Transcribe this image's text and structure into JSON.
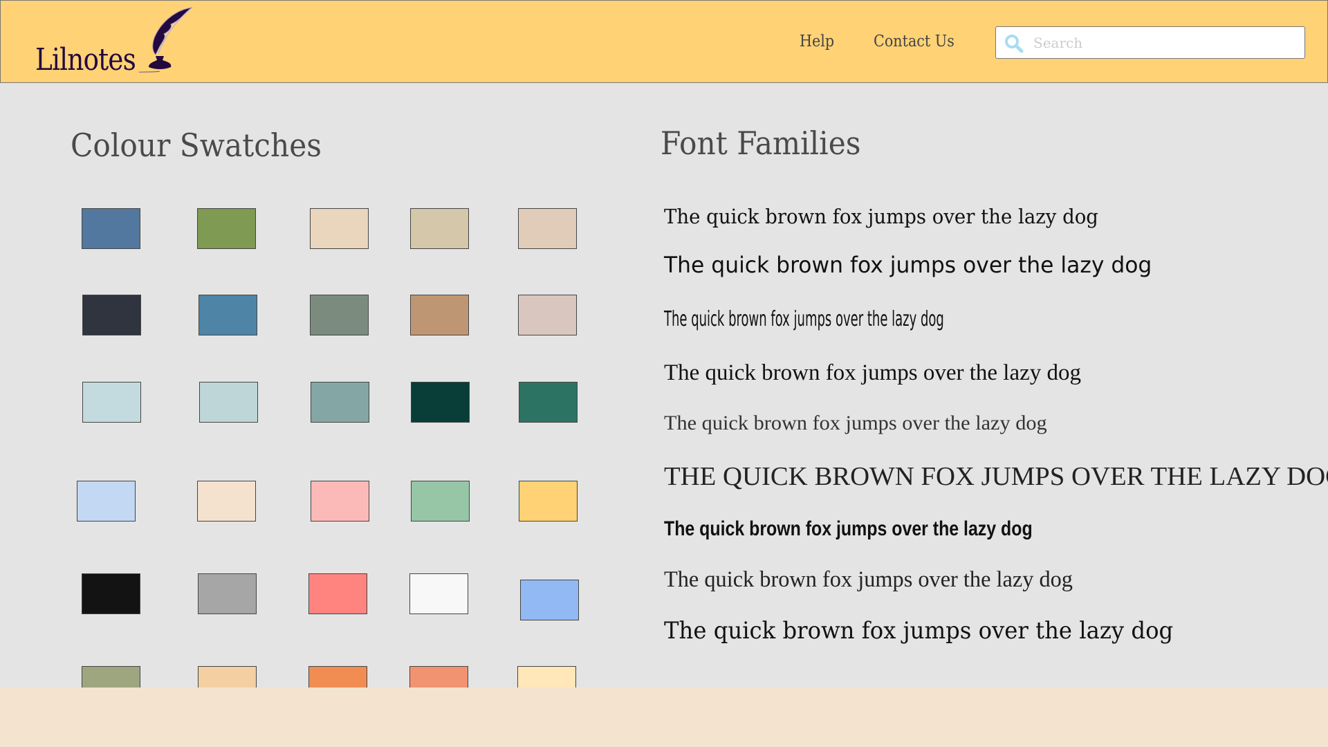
{
  "header": {
    "logo_text": "Lilnotes",
    "nav": [
      {
        "label": "Help"
      },
      {
        "label": "Contact Us"
      }
    ],
    "search": {
      "placeholder": "Search",
      "value": ""
    },
    "background": "#ffd275"
  },
  "swatches": {
    "title": "Colour Swatches",
    "rows": [
      [
        "#52789f",
        "#7f9a53",
        "#ead6bd",
        "#d5c7aa",
        "#e1cbb9"
      ],
      [
        "#30343f",
        "#4e84a6",
        "#7b8c7e",
        "#bf9674",
        "#d9c7bf"
      ],
      [
        "#c3dbdf",
        "#bed6d8",
        "#84a6a4",
        "#083e37",
        "#2c7364"
      ],
      [
        "#c3d8f2",
        "#f4e2cf",
        "#fbbab7",
        "#96c6a6",
        "#ffd275"
      ],
      [
        "#131313",
        "#a7a6a7",
        "#ff8480",
        "#f8f8f8",
        "#92b9f3"
      ],
      [
        "#9ea680",
        "#f4cfa1",
        "#f18d52",
        "#f19370",
        "#ffe7ba"
      ]
    ]
  },
  "fonts": {
    "title": "Font Families",
    "samples": [
      "The quick brown fox jumps over the lazy dog",
      "The quick brown fox jumps over the lazy dog",
      "The quick brown fox jumps over the lazy dog",
      "The quick brown fox jumps over the lazy dog",
      "The quick brown fox jumps over the lazy dog",
      "THE QUICK BROWN FOX JUMPS OVER THE LAZY DOG",
      "The quick brown fox jumps over the lazy dog",
      "The quick brown fox jumps over the lazy dog",
      "The quick brown fox jumps over the lazy dog"
    ]
  }
}
